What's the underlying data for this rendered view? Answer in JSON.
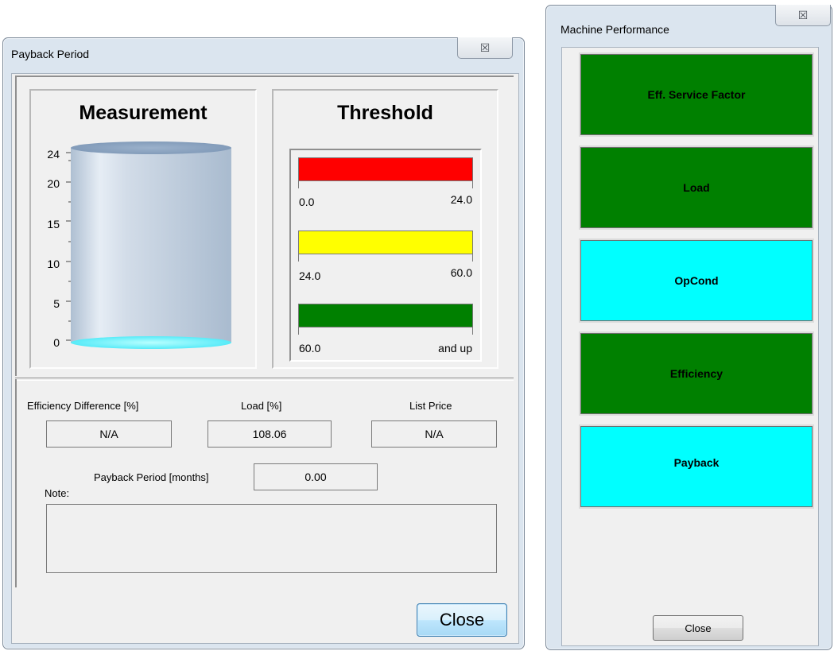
{
  "payback_window": {
    "title": "Payback Period",
    "close_x": "☒",
    "measurement": {
      "title": "Measurement",
      "ticks": [
        "24",
        "20",
        "15",
        "10",
        "5",
        "0"
      ],
      "fill_level": 0.0
    },
    "threshold": {
      "title": "Threshold",
      "ranges": [
        {
          "color": "#ff0000",
          "low": "0.0",
          "high": "24.0"
        },
        {
          "color": "#ffff00",
          "low": "24.0",
          "high": "60.0"
        },
        {
          "color": "#008000",
          "low": "60.0",
          "high": "and up"
        }
      ]
    },
    "fields": {
      "efficiency_label": "Efficiency Difference [%]",
      "efficiency_value": "N/A",
      "load_label": "Load [%]",
      "load_value": "108.06",
      "list_price_label": "List Price",
      "list_price_value": "N/A",
      "payback_label": "Payback Period [months]",
      "payback_value": "0.00",
      "note_label": "Note:",
      "note_value": ""
    },
    "close_button": "Close"
  },
  "machine_window": {
    "title": "Machine Performance",
    "close_x": "☒",
    "buttons": [
      {
        "label": "Eff. Service Factor",
        "color": "#008000"
      },
      {
        "label": "Load",
        "color": "#008000"
      },
      {
        "label": "OpCond",
        "color": "#00ffff"
      },
      {
        "label": "Efficiency",
        "color": "#008000"
      },
      {
        "label": "Payback",
        "color": "#00ffff"
      }
    ],
    "close_button": "Close"
  },
  "colors": {
    "green": "#008000",
    "cyan": "#00ffff",
    "red": "#ff0000",
    "yellow": "#ffff00"
  }
}
